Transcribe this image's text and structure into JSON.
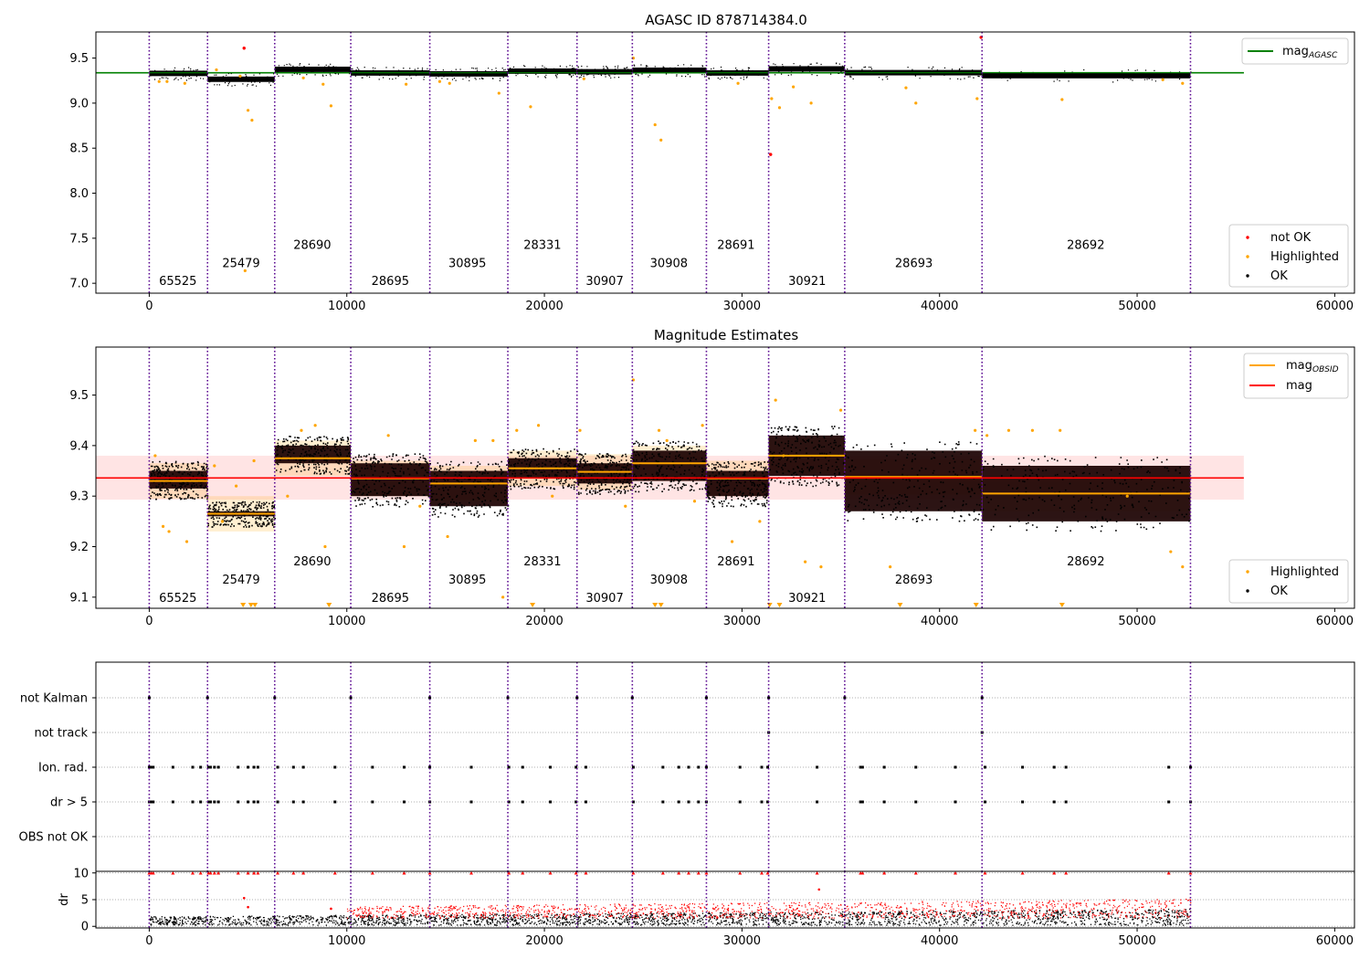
{
  "colors": {
    "vline": "#5b0a91",
    "agasc_line": "#008000",
    "highlight": "#ffa500",
    "not_ok": "#ff0000",
    "ok": "#000000",
    "mag_line": "#ff0000",
    "band": "#ffb3b3",
    "grid": "#b0b0b0"
  },
  "chart_data": [
    {
      "type": "scatter",
      "title": "AGASC ID 878714384.0",
      "xlim": [
        -2700,
        61000
      ],
      "ylim": [
        6.89,
        9.79
      ],
      "xticks": [
        0,
        10000,
        20000,
        30000,
        40000,
        50000,
        60000
      ],
      "xtick_labels": [
        "0",
        "10000",
        "20000",
        "30000",
        "40000",
        "50000",
        "60000"
      ],
      "yticks": [
        7.0,
        7.5,
        8.0,
        8.5,
        9.0,
        9.5
      ],
      "ytick_labels": [
        "7.0",
        "7.5",
        "8.0",
        "8.5",
        "9.0",
        "9.5"
      ],
      "obs_boundaries": [
        0,
        2950,
        6350,
        10200,
        14200,
        18150,
        21650,
        24450,
        28200,
        31350,
        35200,
        42150,
        52700
      ],
      "obsids": [
        {
          "label": "65525",
          "x": 1450,
          "y": 7.03
        },
        {
          "label": "25479",
          "x": 4650,
          "y": 7.23
        },
        {
          "label": "28690",
          "x": 8250,
          "y": 7.43
        },
        {
          "label": "28695",
          "x": 12200,
          "y": 7.03
        },
        {
          "label": "30895",
          "x": 16100,
          "y": 7.23
        },
        {
          "label": "28331",
          "x": 19900,
          "y": 7.43
        },
        {
          "label": "30907",
          "x": 23050,
          "y": 7.03
        },
        {
          "label": "30908",
          "x": 26300,
          "y": 7.23
        },
        {
          "label": "28691",
          "x": 29700,
          "y": 7.43
        },
        {
          "label": "30921",
          "x": 33300,
          "y": 7.03
        },
        {
          "label": "28693",
          "x": 38700,
          "y": 7.23
        },
        {
          "label": "28692",
          "x": 47400,
          "y": 7.43
        }
      ],
      "agasc_mag": {
        "value": 9.337,
        "xrange": [
          -2700,
          55400
        ]
      },
      "segments": [
        {
          "start": 0,
          "end": 2950,
          "mag": 9.33
        },
        {
          "start": 2950,
          "end": 6350,
          "mag": 9.265
        },
        {
          "start": 6350,
          "end": 10200,
          "mag": 9.375
        },
        {
          "start": 10200,
          "end": 14200,
          "mag": 9.335
        },
        {
          "start": 14200,
          "end": 18150,
          "mag": 9.325
        },
        {
          "start": 18150,
          "end": 21650,
          "mag": 9.355
        },
        {
          "start": 21650,
          "end": 24450,
          "mag": 9.348
        },
        {
          "start": 24450,
          "end": 28200,
          "mag": 9.365
        },
        {
          "start": 28200,
          "end": 31350,
          "mag": 9.335
        },
        {
          "start": 31350,
          "end": 35200,
          "mag": 9.38
        },
        {
          "start": 35200,
          "end": 42150,
          "mag": 9.338
        },
        {
          "start": 42150,
          "end": 52700,
          "mag": 9.305
        }
      ],
      "highlighted_points": [
        [
          900,
          9.24
        ],
        [
          500,
          9.24
        ],
        [
          1800,
          9.22
        ],
        [
          3400,
          9.37
        ],
        [
          4600,
          9.3
        ],
        [
          5000,
          8.92
        ],
        [
          5200,
          8.81
        ],
        [
          4850,
          7.14
        ],
        [
          7800,
          9.28
        ],
        [
          8800,
          9.21
        ],
        [
          9200,
          8.97
        ],
        [
          13000,
          9.21
        ],
        [
          14700,
          9.24
        ],
        [
          15200,
          9.22
        ],
        [
          17700,
          9.11
        ],
        [
          19300,
          8.96
        ],
        [
          22000,
          9.27
        ],
        [
          24500,
          9.5
        ],
        [
          25600,
          8.76
        ],
        [
          25900,
          8.59
        ],
        [
          29800,
          9.22
        ],
        [
          31500,
          9.05
        ],
        [
          31900,
          8.95
        ],
        [
          32600,
          9.18
        ],
        [
          33500,
          9.0
        ],
        [
          38300,
          9.17
        ],
        [
          38800,
          9.0
        ],
        [
          41900,
          9.05
        ],
        [
          46200,
          9.04
        ],
        [
          51300,
          9.26
        ],
        [
          52300,
          9.22
        ]
      ],
      "not_ok_points": [
        [
          4800,
          9.61
        ],
        [
          31450,
          8.43
        ],
        [
          42100,
          9.73
        ]
      ],
      "legend_top": [
        {
          "label": "mag",
          "sub": "AGASC"
        }
      ],
      "legend_bottom": [
        {
          "label": "not OK"
        },
        {
          "label": "Highlighted"
        },
        {
          "label": "OK"
        }
      ]
    },
    {
      "type": "scatter",
      "title": "Magnitude Estimates",
      "xlim": [
        -2700,
        61000
      ],
      "ylim": [
        9.078,
        9.595
      ],
      "xticks": [
        0,
        10000,
        20000,
        30000,
        40000,
        50000,
        60000
      ],
      "xtick_labels": [
        "0",
        "10000",
        "20000",
        "30000",
        "40000",
        "50000",
        "60000"
      ],
      "yticks": [
        9.1,
        9.2,
        9.3,
        9.4,
        9.5
      ],
      "ytick_labels": [
        "9.1",
        "9.2",
        "9.3",
        "9.4",
        "9.5"
      ],
      "mag": {
        "value": 9.336,
        "band": [
          9.293,
          9.38
        ],
        "xrange": [
          -2700,
          55400
        ]
      },
      "obsids": [
        {
          "label": "65525",
          "x": 1450,
          "y": 9.1
        },
        {
          "label": "25479",
          "x": 4650,
          "y": 9.136
        },
        {
          "label": "28690",
          "x": 8250,
          "y": 9.172
        },
        {
          "label": "28695",
          "x": 12200,
          "y": 9.1
        },
        {
          "label": "30895",
          "x": 16100,
          "y": 9.136
        },
        {
          "label": "28331",
          "x": 19900,
          "y": 9.172
        },
        {
          "label": "30907",
          "x": 23050,
          "y": 9.1
        },
        {
          "label": "30908",
          "x": 26300,
          "y": 9.136
        },
        {
          "label": "28691",
          "x": 29700,
          "y": 9.172
        },
        {
          "label": "30921",
          "x": 33300,
          "y": 9.1
        },
        {
          "label": "28693",
          "x": 38700,
          "y": 9.136
        },
        {
          "label": "28692",
          "x": 47400,
          "y": 9.172
        }
      ],
      "spread": [
        {
          "lo": 9.295,
          "hi": 9.37
        },
        {
          "lo": 9.24,
          "hi": 9.29
        },
        {
          "lo": 9.345,
          "hi": 9.42
        },
        {
          "lo": 9.28,
          "hi": 9.385
        },
        {
          "lo": 9.26,
          "hi": 9.37
        },
        {
          "lo": 9.315,
          "hi": 9.395
        },
        {
          "lo": 9.305,
          "hi": 9.385
        },
        {
          "lo": 9.31,
          "hi": 9.41
        },
        {
          "lo": 9.28,
          "hi": 9.37
        },
        {
          "lo": 9.32,
          "hi": 9.44
        },
        {
          "lo": 9.25,
          "hi": 9.41
        },
        {
          "lo": 9.23,
          "hi": 9.38
        }
      ],
      "highlighted_points": [
        [
          300,
          9.38
        ],
        [
          700,
          9.24
        ],
        [
          1000,
          9.23
        ],
        [
          1900,
          9.21
        ],
        [
          3300,
          9.36
        ],
        [
          3700,
          9.25
        ],
        [
          4400,
          9.32
        ],
        [
          5300,
          9.37
        ],
        [
          7000,
          9.3
        ],
        [
          7700,
          9.43
        ],
        [
          8400,
          9.44
        ],
        [
          8900,
          9.2
        ],
        [
          12100,
          9.42
        ],
        [
          12900,
          9.2
        ],
        [
          13700,
          9.28
        ],
        [
          15100,
          9.22
        ],
        [
          16500,
          9.41
        ],
        [
          17400,
          9.41
        ],
        [
          17900,
          9.1
        ],
        [
          18600,
          9.43
        ],
        [
          19700,
          9.44
        ],
        [
          20400,
          9.3
        ],
        [
          21800,
          9.43
        ],
        [
          24100,
          9.28
        ],
        [
          24500,
          9.53
        ],
        [
          25800,
          9.43
        ],
        [
          26200,
          9.41
        ],
        [
          27600,
          9.29
        ],
        [
          28000,
          9.44
        ],
        [
          29500,
          9.21
        ],
        [
          30900,
          9.25
        ],
        [
          31700,
          9.49
        ],
        [
          32100,
          9.38
        ],
        [
          33200,
          9.17
        ],
        [
          34000,
          9.16
        ],
        [
          35000,
          9.47
        ],
        [
          37500,
          9.16
        ],
        [
          41800,
          9.43
        ],
        [
          42400,
          9.42
        ],
        [
          43500,
          9.43
        ],
        [
          44700,
          9.43
        ],
        [
          46100,
          9.43
        ],
        [
          49500,
          9.3
        ],
        [
          51700,
          9.19
        ],
        [
          52300,
          9.16
        ]
      ],
      "clipped_points": [
        4750,
        5150,
        5350,
        9100,
        19400,
        25600,
        25900,
        31400,
        31900,
        38000,
        41850,
        46200
      ],
      "legend_top": [
        {
          "label": "mag",
          "sub": "OBSID"
        },
        {
          "label": "mag"
        }
      ],
      "legend_bottom": [
        {
          "label": "Highlighted"
        },
        {
          "label": "OK"
        }
      ]
    },
    {
      "type": "scatter",
      "categories": [
        "not Kalman",
        "not track",
        "Ion. rad.",
        "dr > 5",
        "OBS not OK"
      ],
      "xlim": [
        -2700,
        61000
      ],
      "flag_points": {
        "not Kalman": [
          0,
          2950,
          6350,
          10200,
          14200,
          18150,
          21650,
          24450,
          28200,
          31350,
          35200,
          42150
        ],
        "not track": [
          31350,
          42150
        ],
        "Ion. rad.": [
          0,
          100,
          200,
          1200,
          2200,
          2600,
          3000,
          3100,
          3300,
          3500,
          4500,
          5000,
          5300,
          5500,
          6500,
          7300,
          7800,
          9400,
          11300,
          12900,
          14200,
          16300,
          18200,
          18900,
          20300,
          21600,
          22100,
          24500,
          26000,
          26800,
          27300,
          27800,
          28200,
          29900,
          31000,
          31300,
          33800,
          36000,
          36100,
          37200,
          38800,
          40800,
          42300,
          44200,
          45800,
          46400,
          51600,
          52700
        ],
        "dr > 5": [
          0,
          100,
          200,
          1200,
          2200,
          2600,
          3000,
          3100,
          3300,
          3500,
          4500,
          5000,
          5300,
          5500,
          6500,
          7300,
          7800,
          9400,
          11300,
          12900,
          14200,
          16300,
          18200,
          18900,
          20300,
          21600,
          22100,
          24500,
          26000,
          26800,
          27300,
          27800,
          28200,
          29900,
          31000,
          31300,
          33800,
          36000,
          36100,
          37200,
          38800,
          40800,
          42300,
          44200,
          45800,
          46400,
          51600,
          52700
        ],
        "OBS not OK": []
      }
    },
    {
      "type": "scatter",
      "ylabel": "dr",
      "xlim": [
        -2700,
        61000
      ],
      "ylim": [
        -0.3,
        10.3
      ],
      "xticks": [
        0,
        10000,
        20000,
        30000,
        40000,
        50000,
        60000
      ],
      "xtick_labels": [
        "0",
        "10000",
        "20000",
        "30000",
        "40000",
        "50000",
        "60000"
      ],
      "yticks": [
        0,
        5,
        10
      ],
      "ytick_labels": [
        "0",
        "5",
        "10"
      ],
      "outliers_high": [
        0,
        100,
        200,
        1200,
        2200,
        2600,
        3000,
        3100,
        3300,
        3500,
        4500,
        5000,
        5300,
        5500,
        6500,
        7300,
        7800,
        9400,
        11300,
        12900,
        14200,
        16300,
        18200,
        18900,
        20300,
        21600,
        22100,
        24500,
        26000,
        26800,
        27300,
        27800,
        28200,
        29900,
        31000,
        31300,
        33800,
        36000,
        36100,
        37200,
        38800,
        40800,
        42300,
        44200,
        45800,
        46400,
        51600,
        52700
      ],
      "scattered_red": [
        [
          4800,
          5.3
        ],
        [
          5000,
          3.6
        ],
        [
          9200,
          3.3
        ],
        [
          33900,
          6.9
        ]
      ]
    }
  ]
}
